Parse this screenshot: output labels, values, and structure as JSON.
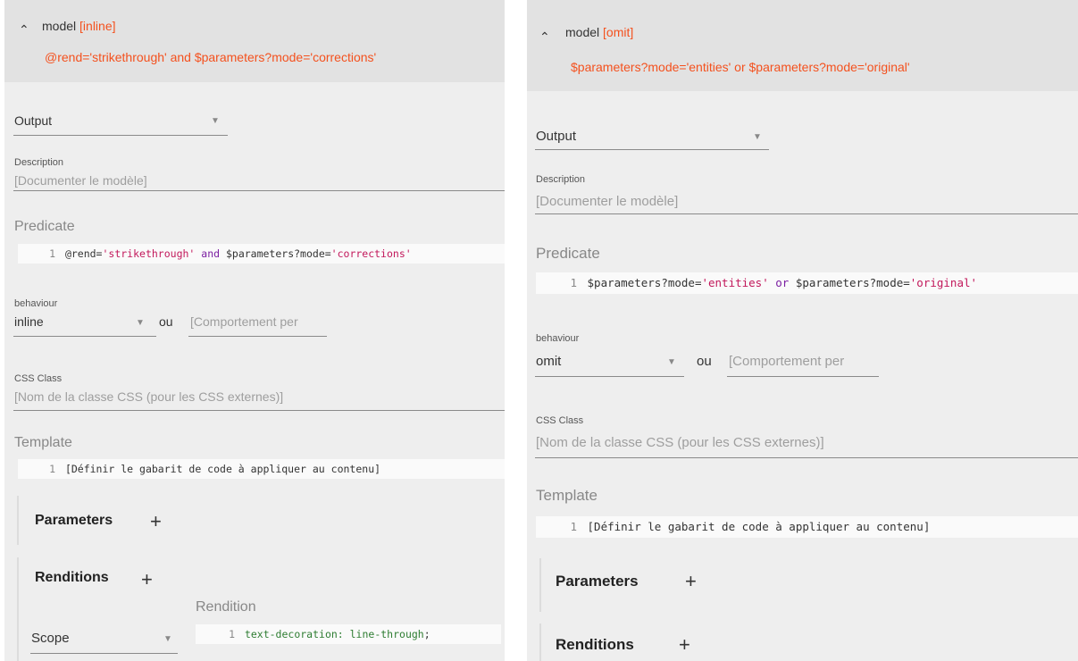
{
  "left": {
    "model_label": "model",
    "model_type": "[inline]",
    "predicate_summary": "@rend='strikethrough' and $parameters?mode='corrections'",
    "output_value": "Output",
    "description_label": "Description",
    "description_placeholder": "[Documenter le modèle]",
    "predicate_label": "Predicate",
    "predicate_code": {
      "line": "1",
      "t1": "@rend=",
      "t2": "'strikethrough'",
      "t3": " and ",
      "t4": "$parameters?mode=",
      "t5": "'corrections'"
    },
    "behaviour_label": "behaviour",
    "behaviour_value": "inline",
    "ou": "ou",
    "custom_behaviour_placeholder": "[Comportement per",
    "css_class_label": "CSS Class",
    "css_class_placeholder": "[Nom de la classe CSS (pour les CSS externes)]",
    "template_label": "Template",
    "template_code": {
      "line": "1",
      "text": "[Définir le gabarit de code à appliquer au contenu]"
    },
    "parameters_label": "Parameters",
    "renditions_label": "Renditions",
    "plus": "+",
    "rendition_label": "Rendition",
    "scope_value": "Scope",
    "rendition_code": {
      "line": "1",
      "prop": "text-decoration: line-through",
      "semi": ";"
    }
  },
  "right": {
    "model_label": "model",
    "model_type": "[omit]",
    "predicate_summary": "$parameters?mode='entities' or $parameters?mode='original'",
    "output_value": "Output",
    "description_label": "Description",
    "description_placeholder": "[Documenter le modèle]",
    "predicate_label": "Predicate",
    "predicate_code": {
      "line": "1",
      "t1": "$parameters?mode=",
      "t2": "'entities'",
      "t3": " or ",
      "t4": "$parameters?mode=",
      "t5": "'original'"
    },
    "behaviour_label": "behaviour",
    "behaviour_value": "omit",
    "ou": "ou",
    "custom_behaviour_placeholder": "[Comportement per",
    "css_class_label": "CSS Class",
    "css_class_placeholder": "[Nom de la classe CSS (pour les CSS externes)]",
    "template_label": "Template",
    "template_code": {
      "line": "1",
      "text": "[Définir le gabarit de code à appliquer au contenu]"
    },
    "parameters_label": "Parameters",
    "renditions_label": "Renditions",
    "plus": "+"
  },
  "icons": {
    "collapse": "chevron-up-icon",
    "dropdown": "dropdown-arrow-icon",
    "add": "plus-icon"
  },
  "colors": {
    "accent": "#f4511e",
    "header_bg": "#e2e2e2",
    "panel_bg": "#eeeeee",
    "string": "#c2185b",
    "keyword": "#7b1fa2",
    "css_property": "#2e7d32"
  }
}
